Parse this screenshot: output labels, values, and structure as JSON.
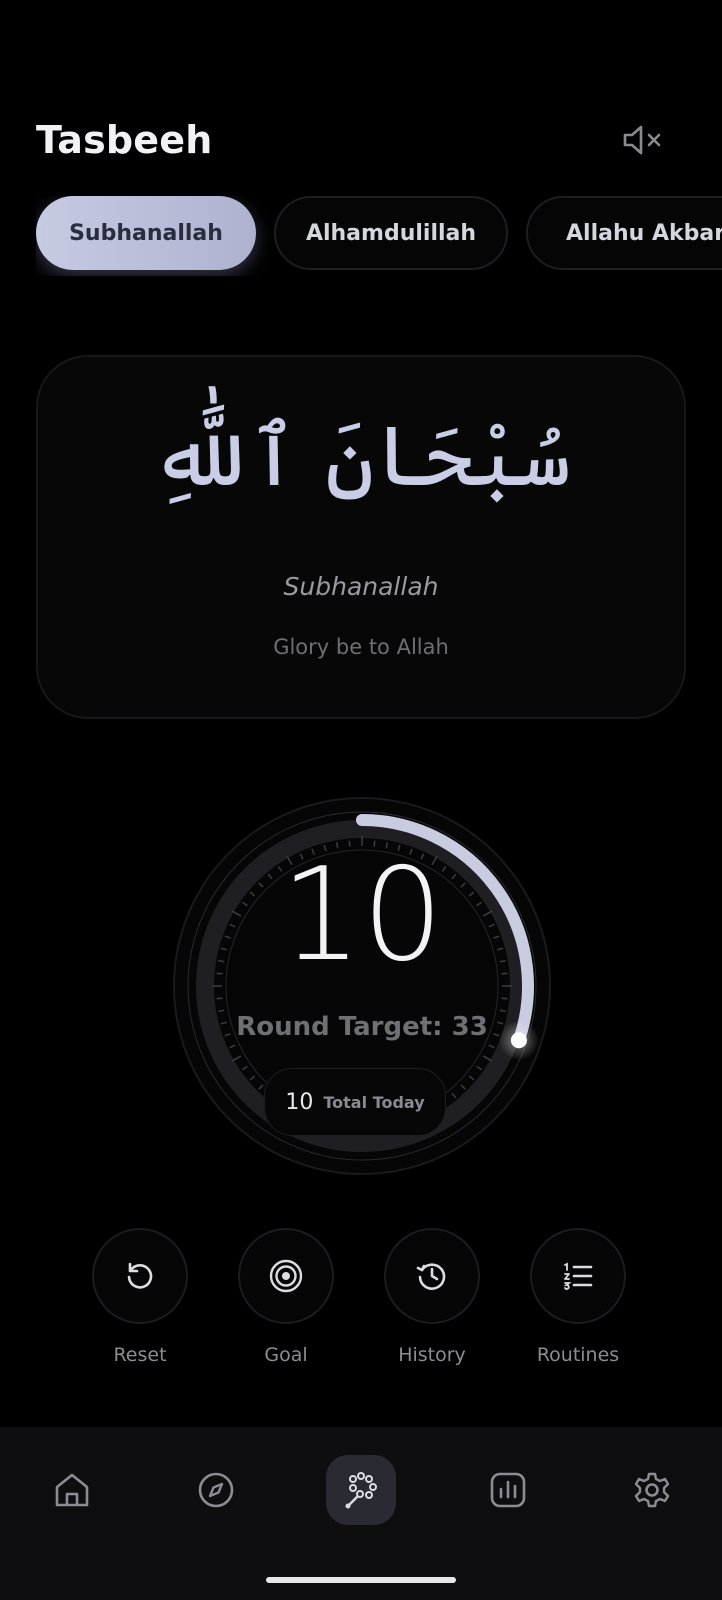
{
  "header": {
    "title": "Tasbeeh",
    "mute_icon": "speaker-mute-icon"
  },
  "dhikr_tabs": [
    {
      "label": "Subhanallah",
      "active": true
    },
    {
      "label": "Alhamdulillah",
      "active": false
    },
    {
      "label": "Allahu Akbar",
      "active": false
    }
  ],
  "dhikr_card": {
    "arabic": "سُبْحَانَ ٱللَّٰهِ",
    "transliteration": "Subhanallah",
    "meaning": "Glory be to Allah"
  },
  "counter": {
    "count": "10",
    "round_target_label": "Round Target: 33",
    "progress_fraction": 0.303,
    "total_today_value": "10",
    "total_today_label": "Total Today"
  },
  "actions": [
    {
      "label": "Reset",
      "icon": "reset-icon"
    },
    {
      "label": "Goal",
      "icon": "target-icon"
    },
    {
      "label": "History",
      "icon": "history-icon"
    },
    {
      "label": "Routines",
      "icon": "list-icon"
    }
  ],
  "bottom_nav": [
    {
      "icon": "home-icon",
      "active": false
    },
    {
      "icon": "compass-icon",
      "active": false
    },
    {
      "icon": "tasbeeh-beads-icon",
      "active": true
    },
    {
      "icon": "stats-icon",
      "active": false
    },
    {
      "icon": "settings-icon",
      "active": false
    }
  ],
  "colors": {
    "accent": "#c7cae3",
    "background": "#000000",
    "text_muted": "#6f6f76"
  }
}
